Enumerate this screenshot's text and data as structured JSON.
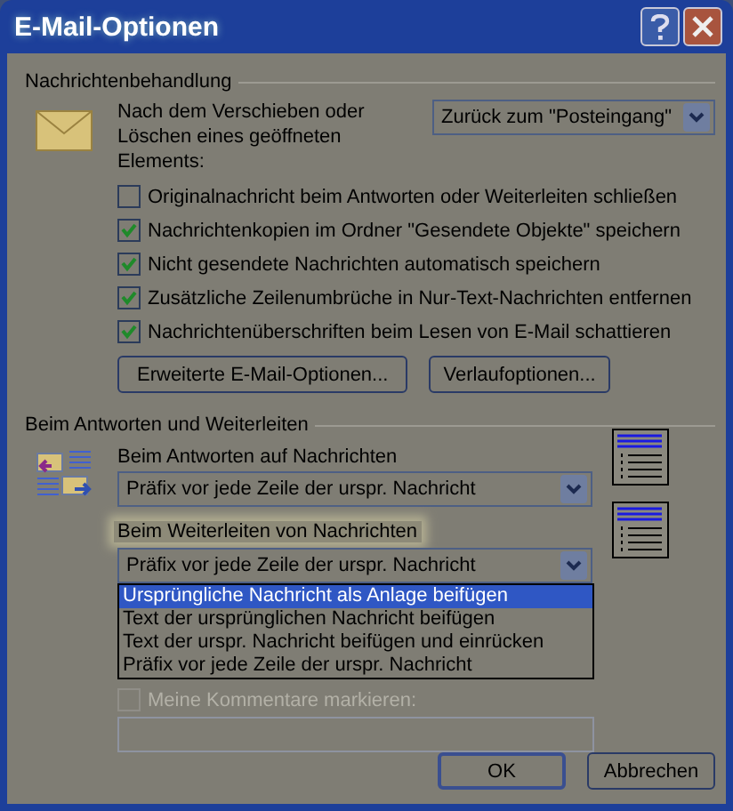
{
  "window": {
    "title": "E-Mail-Optionen"
  },
  "handling": {
    "heading": "Nachrichtenbehandlung",
    "move_label": "Nach dem Verschieben oder Löschen eines geöffneten Elements:",
    "move_value": "Zurück zum \"Posteingang\"",
    "options": [
      {
        "label": "Originalnachricht beim Antworten oder Weiterleiten schließen",
        "checked": false
      },
      {
        "label": "Nachrichtenkopien im Ordner \"Gesendete Objekte\" speichern",
        "checked": true
      },
      {
        "label": "Nicht gesendete Nachrichten automatisch speichern",
        "checked": true
      },
      {
        "label": "Zusätzliche Zeilenumbrüche in Nur-Text-Nachrichten entfernen",
        "checked": true
      },
      {
        "label": "Nachrichtenüberschriften beim Lesen von E-Mail schattieren",
        "checked": true
      }
    ],
    "buttons": [
      "Erweiterte E-Mail-Optionen...",
      "Verlaufoptionen..."
    ]
  },
  "reply": {
    "heading": "Beim Antworten und Weiterleiten",
    "reply_label": "Beim Antworten auf Nachrichten",
    "reply_value": "Präfix vor jede Zeile der urspr. Nachricht",
    "forward_label": "Beim Weiterleiten von Nachrichten",
    "forward_value": "Präfix vor jede Zeile der urspr. Nachricht",
    "forward_options": [
      {
        "label": "Ursprüngliche Nachricht als Anlage beifügen",
        "selected": true
      },
      {
        "label": "Text der ursprünglichen Nachricht beifügen",
        "selected": false
      },
      {
        "label": "Text der urspr. Nachricht beifügen und einrücken",
        "selected": false
      },
      {
        "label": "Präfix vor jede Zeile der urspr. Nachricht",
        "selected": false
      }
    ],
    "mark_comments": {
      "label": "Meine Kommentare markieren:",
      "checked": false,
      "disabled": true
    }
  },
  "buttons": [
    "OK",
    "Abbrechen"
  ]
}
